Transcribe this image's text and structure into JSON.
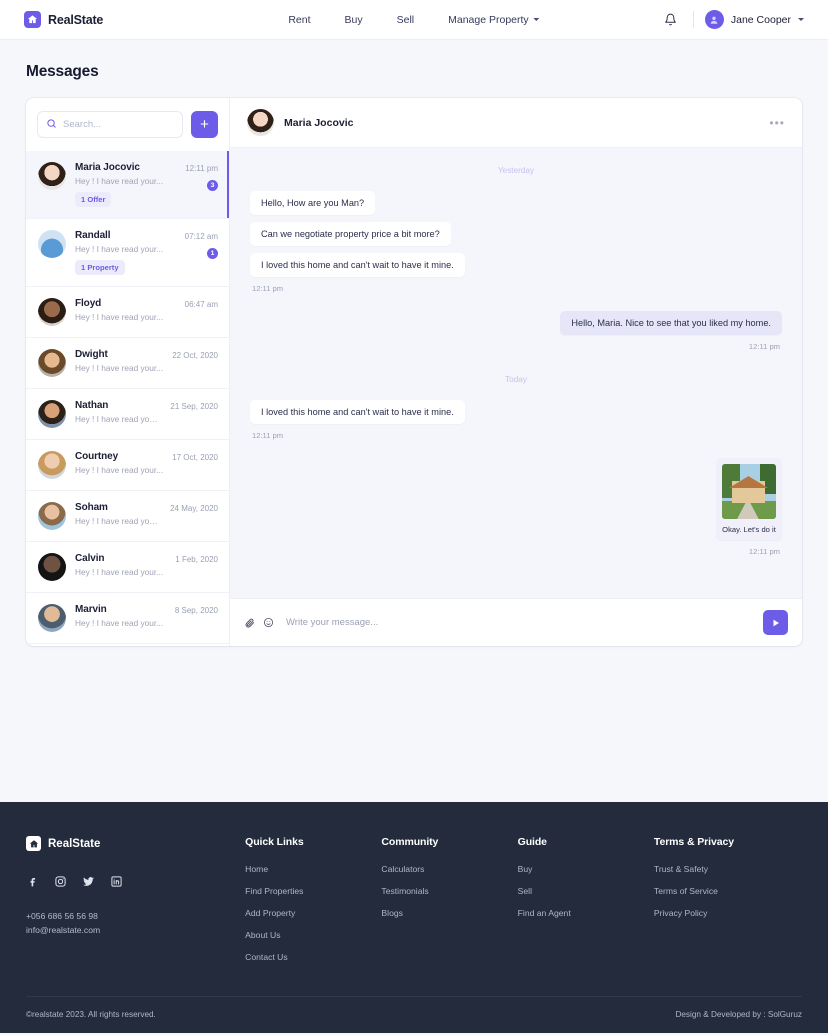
{
  "nav": {
    "brand": "RealState",
    "links": [
      {
        "label": "Rent",
        "has_caret": false
      },
      {
        "label": "Buy",
        "has_caret": false
      },
      {
        "label": "Sell",
        "has_caret": false
      },
      {
        "label": "Manage Property",
        "has_caret": true
      }
    ],
    "notification_icon": "bell-icon",
    "user": "Jane Cooper"
  },
  "page": {
    "title": "Messages"
  },
  "search": {
    "placeholder": "Search...",
    "value": "",
    "add_label": "+"
  },
  "conversations": [
    {
      "name": "Maria Jocovic",
      "preview": "Hey ! I have read your...",
      "time": "12:11 pm",
      "tag": "1 Offer",
      "unread": "3",
      "active": true
    },
    {
      "name": "Randall",
      "preview": "Hey ! I have read your...",
      "time": "07:12 am",
      "tag": "1 Property",
      "unread": "1",
      "active": false
    },
    {
      "name": "Floyd",
      "preview": "Hey ! I have read your...",
      "time": "06:47 am",
      "tag": "",
      "unread": "",
      "active": false
    },
    {
      "name": "Dwight",
      "preview": "Hey ! I have read your...",
      "time": "22 Oct, 2020",
      "tag": "",
      "unread": "",
      "active": false
    },
    {
      "name": "Nathan",
      "preview": "Hey ! I have read your...",
      "time": "21 Sep, 2020",
      "tag": "",
      "unread": "",
      "active": false
    },
    {
      "name": "Courtney",
      "preview": "Hey ! I have read your...",
      "time": "17 Oct, 2020",
      "tag": "",
      "unread": "",
      "active": false
    },
    {
      "name": "Soham",
      "preview": "Hey ! I have read your...",
      "time": "24 May, 2020",
      "tag": "",
      "unread": "",
      "active": false
    },
    {
      "name": "Calvin",
      "preview": "Hey ! I have read your...",
      "time": "1 Feb, 2020",
      "tag": "",
      "unread": "",
      "active": false
    },
    {
      "name": "Marvin",
      "preview": "Hey ! I have read your...",
      "time": "8 Sep, 2020",
      "tag": "",
      "unread": "",
      "active": false
    }
  ],
  "chat": {
    "header_name": "Maria Jocovic",
    "menu_icon": "more-options-icon",
    "separator_yesterday": "Yesterday",
    "separator_today": "Today",
    "in1": "Hello, How are you Man?",
    "in2": "Can we negotiate property price a bit more?",
    "in3": "I loved this home and can't wait to have it mine.",
    "in_stamp": "12:11 pm",
    "out1": "Hello, Maria. Nice to see that you liked my home.",
    "out1_stamp": "12:11 pm",
    "today_in1": "I loved this home and can't wait to have it mine.",
    "today_in_stamp": "12:11 pm",
    "image_caption": "Okay. Let's do it",
    "image_stamp": "12:11 pm",
    "composer_placeholder": "Write your message...",
    "composer_value": "",
    "attach_icon": "paperclip-icon",
    "emoji_icon": "emoji-icon",
    "send_icon": "send-icon"
  },
  "footer": {
    "brand": "RealState",
    "socials": [
      "facebook-icon",
      "instagram-icon",
      "twitter-icon",
      "linkedin-icon"
    ],
    "phone": "+056 686 56 56 98",
    "email": "info@realstate.com",
    "columns": [
      {
        "title": "Quick Links",
        "links": [
          "Home",
          "Find Properties",
          "Add Property",
          "About Us",
          "Contact Us"
        ]
      },
      {
        "title": "Community",
        "links": [
          "Calculators",
          "Testimonials",
          "Blogs"
        ]
      },
      {
        "title": "Guide",
        "links": [
          "Buy",
          "Sell",
          "Find an Agent"
        ]
      },
      {
        "title": "Terms & Privacy",
        "links": [
          "Trust & Safety",
          "Terms of Service",
          "Privacy Policy"
        ]
      }
    ],
    "copyright": "©realstate 2023. All rights reserved.",
    "credit": "Design & Developed by : SolGuruz"
  },
  "colors": {
    "accent": "#6c5ce7",
    "chat_bg": "#f5f5fc",
    "footer_bg": "#242b3d"
  }
}
